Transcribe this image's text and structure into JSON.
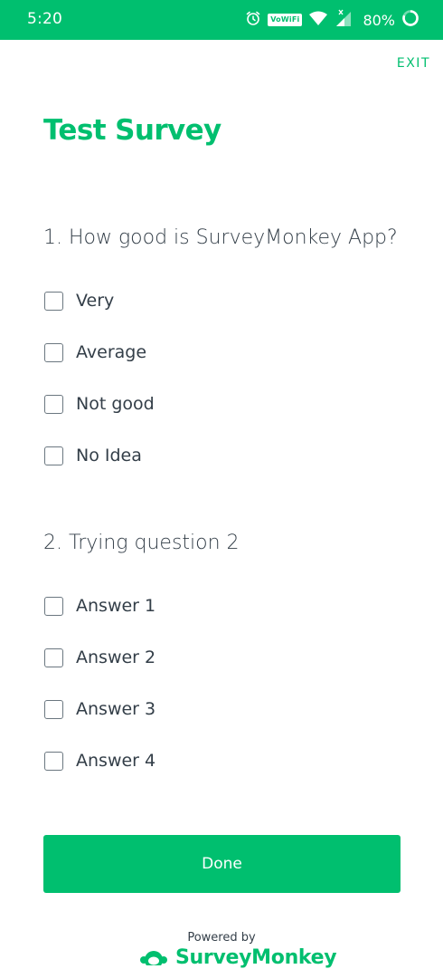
{
  "status_bar": {
    "time": "5:20",
    "network_badge": "VoWiFi",
    "battery_percent": "80%",
    "icons": [
      "alarm-icon",
      "wifi-icon",
      "signal-icon",
      "battery-ring-icon"
    ]
  },
  "header": {
    "exit_label": "EXIT"
  },
  "survey": {
    "title": "Test Survey",
    "questions": [
      {
        "text": "1. How good is SurveyMonkey App?",
        "options": [
          "Very",
          "Average",
          "Not good",
          "No Idea"
        ]
      },
      {
        "text": "2. Trying question 2",
        "options": [
          "Answer 1",
          "Answer 2",
          "Answer 3",
          "Answer 4"
        ]
      }
    ]
  },
  "footer": {
    "done_label": "Done",
    "powered_by": "Powered by",
    "brand_name": "SurveyMonkey"
  },
  "colors": {
    "accent": "#00bf6f",
    "text": "#333e48",
    "checkbox_border": "#6b7780"
  }
}
